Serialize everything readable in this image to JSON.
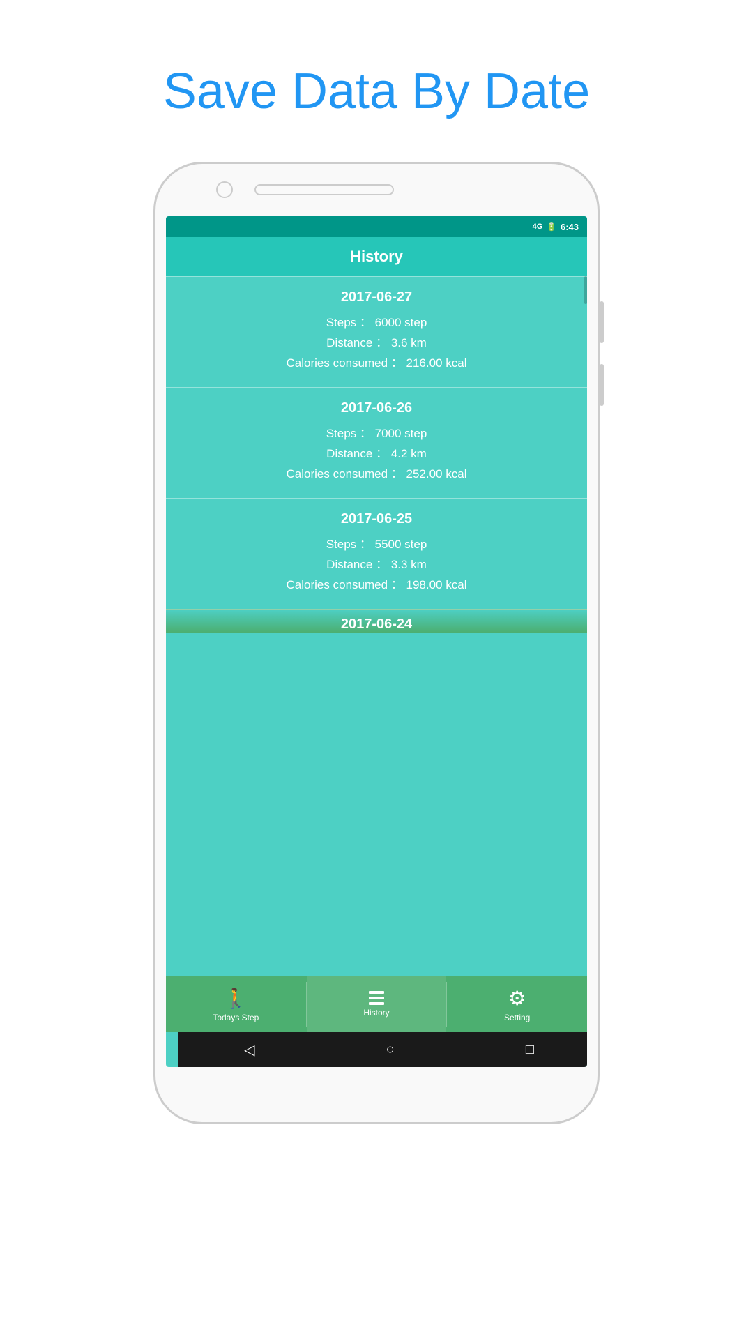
{
  "page": {
    "title": "Save Data By Date"
  },
  "status_bar": {
    "signal": "4G",
    "time": "6:43"
  },
  "app_bar": {
    "title": "History"
  },
  "history_entries": [
    {
      "date": "2017-06-27",
      "steps": "6000 step",
      "distance": "3.6 km",
      "calories": "216.00 kcal"
    },
    {
      "date": "2017-06-26",
      "steps": "7000 step",
      "distance": "4.2 km",
      "calories": "252.00 kcal"
    },
    {
      "date": "2017-06-25",
      "steps": "5500 step",
      "distance": "3.3 km",
      "calories": "198.00 kcal"
    },
    {
      "date": "2017-06-24",
      "steps": "",
      "distance": "",
      "calories": ""
    }
  ],
  "bottom_nav": {
    "items": [
      {
        "label": "Todays Step",
        "icon": "🚶",
        "active": false
      },
      {
        "label": "History",
        "icon": "≡",
        "active": true
      },
      {
        "label": "Setting",
        "icon": "⚙",
        "active": false
      }
    ]
  },
  "labels": {
    "steps_label": "Steps ：",
    "distance_label": "Distance ：",
    "calories_label": "Calories consumed ："
  }
}
